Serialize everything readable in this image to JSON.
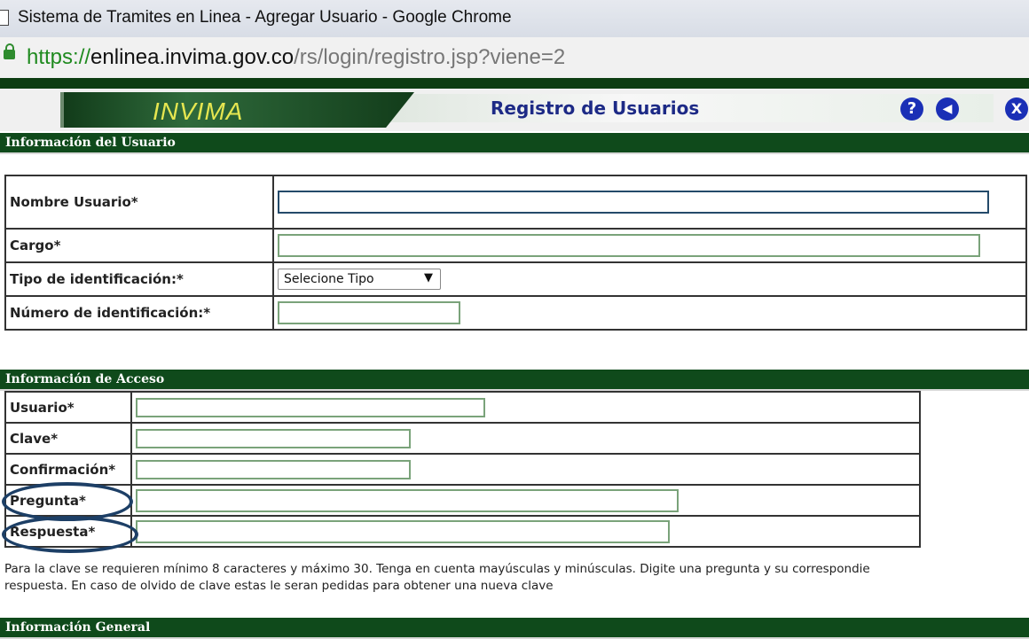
{
  "browser": {
    "window_title": "Sistema de Tramites en Linea - Agregar Usuario - Google Chrome",
    "url_scheme": "https://",
    "url_host": "enlinea.invima.gov.co",
    "url_path": "/rs/login/registro.jsp?viene=2"
  },
  "header": {
    "logo": "INVIMA",
    "title": "Registro de Usuarios",
    "help_icon": "?",
    "back_icon": "◀",
    "close_icon": "X"
  },
  "user_info": {
    "section_title": "Información del Usuario",
    "fields": {
      "nombre_label": "Nombre Usuario*",
      "cargo_label": "Cargo*",
      "tipo_label": "Tipo de identificación:*",
      "tipo_value": "Selecione Tipo",
      "numero_label": "Número de identificación:*"
    }
  },
  "access_info": {
    "section_title": "Información de Acceso",
    "fields": {
      "usuario_label": "Usuario*",
      "clave_label": "Clave*",
      "confirmacion_label": "Confirmación*",
      "pregunta_label": "Pregunta*",
      "respuesta_label": "Respuesta*"
    },
    "note_line1": "Para la clave se requieren mínimo 8 caracteres y máximo 30. Tenga en cuenta mayúsculas y minúsculas. Digite una pregunta y su correspondie",
    "note_line2": "respuesta. En caso de olvido de clave estas le seran pedidas para obtener una nueva clave"
  },
  "general_info": {
    "section_title": "Información General"
  },
  "colors": {
    "section_green": "#0f4a1b",
    "title_blue": "#1d2a86",
    "annotation_circle": "#1d3f66"
  }
}
